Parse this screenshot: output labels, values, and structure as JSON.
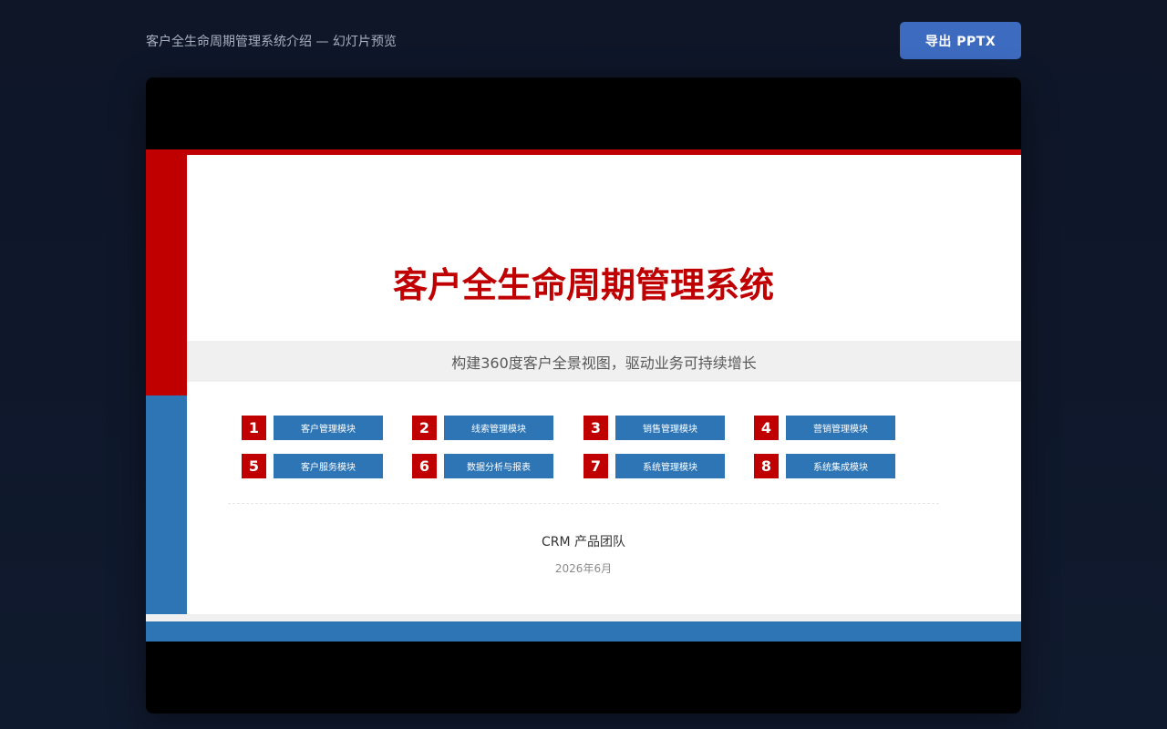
{
  "header": {
    "doc_title": "客户全生命周期管理系统介绍 — 幻灯片预览",
    "export_label": "导出 PPTX"
  },
  "slide": {
    "title": "客户全生命周期管理系统",
    "subtitle": "构建360度客户全景视图，驱动业务可持续增长",
    "modules": [
      {
        "num": "1",
        "label": "客户管理模块"
      },
      {
        "num": "2",
        "label": "线索管理模块"
      },
      {
        "num": "3",
        "label": "销售管理模块"
      },
      {
        "num": "4",
        "label": "营销管理模块"
      },
      {
        "num": "5",
        "label": "客户服务模块"
      },
      {
        "num": "6",
        "label": "数据分析与报表"
      },
      {
        "num": "7",
        "label": "系统管理模块"
      },
      {
        "num": "8",
        "label": "系统集成模块"
      }
    ],
    "team": "CRM 产品团队",
    "date": "2026年6月"
  },
  "colors": {
    "page_bg": "#0f172a",
    "accent_button": "#3d6bc0",
    "slide_red": "#c00000",
    "slide_blue": "#2e75b6",
    "band_grey": "#f0f0f0"
  }
}
